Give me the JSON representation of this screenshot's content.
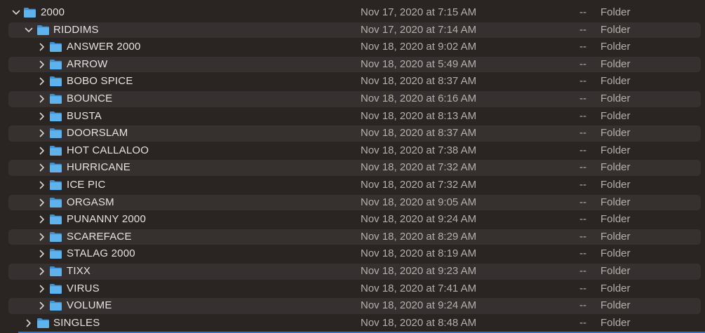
{
  "colors": {
    "background": "#2a2422",
    "alt_row": "#363130",
    "folder_blue": "#5fb3ec",
    "folder_blue_dark": "#3f91d2",
    "text": "#e4e1df",
    "meta_text": "#b3afac",
    "focus_line": "#2b73d6"
  },
  "icons": {
    "chevron_expanded": "chevron-down-icon",
    "chevron_collapsed": "chevron-right-icon",
    "folder": "folder-icon"
  },
  "rows": [
    {
      "name": "2000",
      "date": "Nov 17, 2020 at 7:15 AM",
      "size": "--",
      "kind": "Folder",
      "level": 0,
      "expanded": true
    },
    {
      "name": "RIDDIMS",
      "date": "Nov 17, 2020 at 7:14 AM",
      "size": "--",
      "kind": "Folder",
      "level": 1,
      "expanded": true
    },
    {
      "name": "ANSWER 2000",
      "date": "Nov 18, 2020 at 9:02 AM",
      "size": "--",
      "kind": "Folder",
      "level": 2,
      "expanded": false
    },
    {
      "name": "ARROW",
      "date": "Nov 18, 2020 at 5:49 AM",
      "size": "--",
      "kind": "Folder",
      "level": 2,
      "expanded": false
    },
    {
      "name": "BOBO SPICE",
      "date": "Nov 18, 2020 at 8:37 AM",
      "size": "--",
      "kind": "Folder",
      "level": 2,
      "expanded": false
    },
    {
      "name": "BOUNCE",
      "date": "Nov 18, 2020 at 6:16 AM",
      "size": "--",
      "kind": "Folder",
      "level": 2,
      "expanded": false
    },
    {
      "name": "BUSTA",
      "date": "Nov 18, 2020 at 8:13 AM",
      "size": "--",
      "kind": "Folder",
      "level": 2,
      "expanded": false
    },
    {
      "name": "DOORSLAM",
      "date": "Nov 18, 2020 at 8:37 AM",
      "size": "--",
      "kind": "Folder",
      "level": 2,
      "expanded": false
    },
    {
      "name": "HOT CALLALOO",
      "date": "Nov 18, 2020 at 7:38 AM",
      "size": "--",
      "kind": "Folder",
      "level": 2,
      "expanded": false
    },
    {
      "name": "HURRICANE",
      "date": "Nov 18, 2020 at 7:32 AM",
      "size": "--",
      "kind": "Folder",
      "level": 2,
      "expanded": false
    },
    {
      "name": "ICE PIC",
      "date": "Nov 18, 2020 at 7:32 AM",
      "size": "--",
      "kind": "Folder",
      "level": 2,
      "expanded": false
    },
    {
      "name": "ORGASM",
      "date": "Nov 18, 2020 at 9:05 AM",
      "size": "--",
      "kind": "Folder",
      "level": 2,
      "expanded": false
    },
    {
      "name": "PUNANNY 2000",
      "date": "Nov 18, 2020 at 9:24 AM",
      "size": "--",
      "kind": "Folder",
      "level": 2,
      "expanded": false
    },
    {
      "name": "SCAREFACE",
      "date": "Nov 18, 2020 at 8:29 AM",
      "size": "--",
      "kind": "Folder",
      "level": 2,
      "expanded": false
    },
    {
      "name": "STALAG 2000",
      "date": "Nov 18, 2020 at 8:19 AM",
      "size": "--",
      "kind": "Folder",
      "level": 2,
      "expanded": false
    },
    {
      "name": "TIXX",
      "date": "Nov 18, 2020 at 9:23 AM",
      "size": "--",
      "kind": "Folder",
      "level": 2,
      "expanded": false
    },
    {
      "name": "VIRUS",
      "date": "Nov 18, 2020 at 7:41 AM",
      "size": "--",
      "kind": "Folder",
      "level": 2,
      "expanded": false
    },
    {
      "name": "VOLUME",
      "date": "Nov 18, 2020 at 9:24 AM",
      "size": "--",
      "kind": "Folder",
      "level": 2,
      "expanded": false
    },
    {
      "name": "SINGLES",
      "date": "Nov 18, 2020 at 8:48 AM",
      "size": "--",
      "kind": "Folder",
      "level": 1,
      "expanded": false
    }
  ]
}
